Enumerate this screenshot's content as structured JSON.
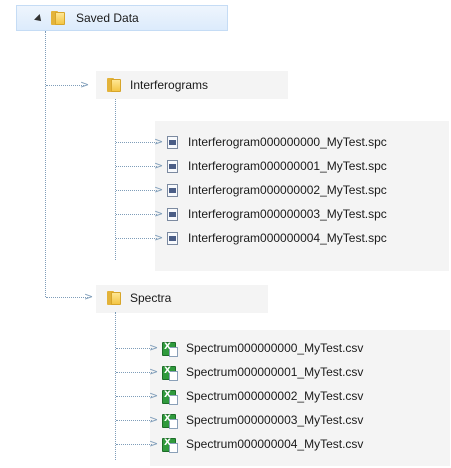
{
  "tree": {
    "root": {
      "label": "Saved Data",
      "expanded": true,
      "children": [
        {
          "label": "Interferograms",
          "files": [
            "Interferogram000000000_MyTest.spc",
            "Interferogram000000001_MyTest.spc",
            "Interferogram000000002_MyTest.spc",
            "Interferogram000000003_MyTest.spc",
            "Interferogram000000004_MyTest.spc"
          ],
          "file_icon": "spc-file-icon"
        },
        {
          "label": "Spectra",
          "files": [
            "Spectrum000000000_MyTest.csv",
            "Spectrum000000001_MyTest.csv",
            "Spectrum000000002_MyTest.csv",
            "Spectrum000000003_MyTest.csv",
            "Spectrum000000004_MyTest.csv"
          ],
          "file_icon": "excel-csv-icon"
        }
      ]
    }
  },
  "icons": {
    "folder": "folder-icon",
    "expander": "expand-triangle-icon",
    "connector": "arrow-connector-icon"
  },
  "colors": {
    "guide_line": "#7f9db9",
    "selection_bg": "#dcebfc",
    "folder": "#f4c545",
    "csv": "#2f9a3c"
  }
}
